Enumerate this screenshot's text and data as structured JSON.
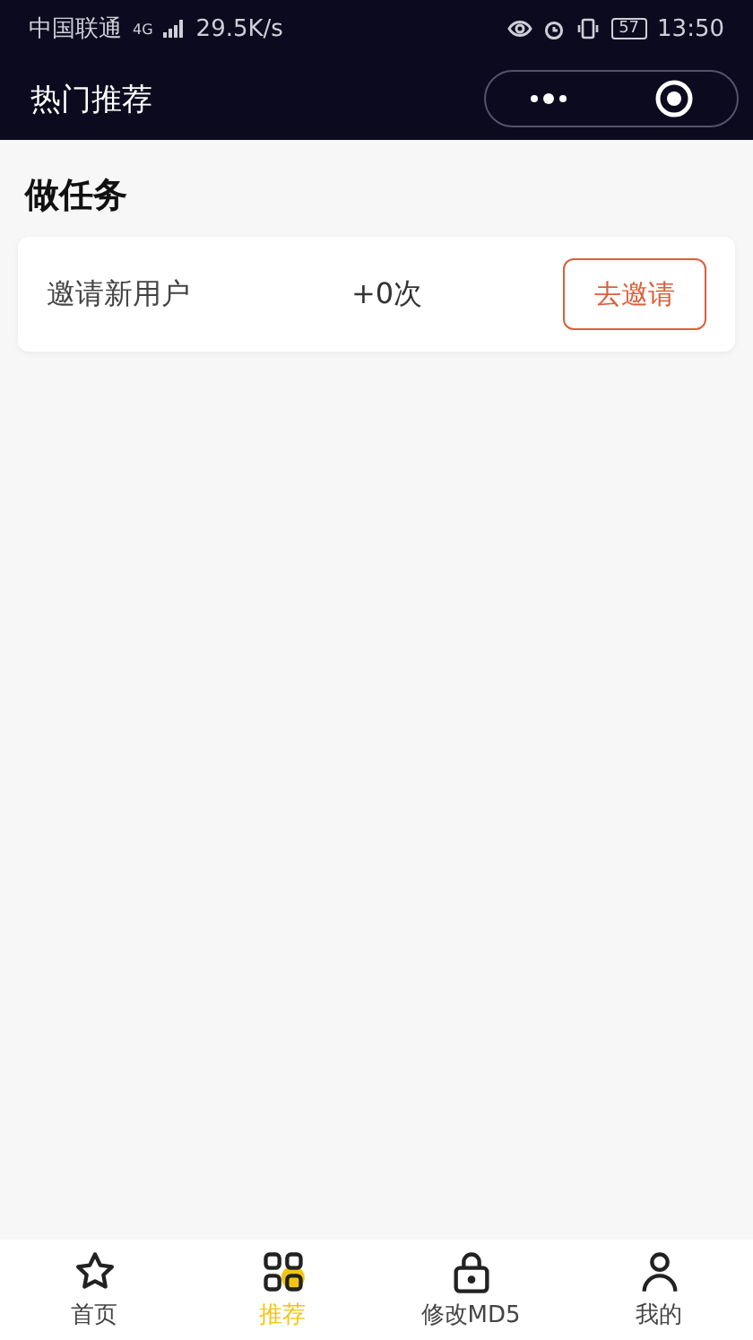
{
  "status_bar": {
    "carrier": "中国联通",
    "network": "4G",
    "speed": "29.5K/s",
    "battery": "57",
    "time": "13:50"
  },
  "nav_bar": {
    "title": "热门推荐"
  },
  "section": {
    "title": "做任务"
  },
  "tasks": [
    {
      "name": "邀请新用户",
      "count": "+0次",
      "action": "去邀请"
    }
  ],
  "tab_bar": [
    {
      "label": "首页",
      "kind": "star",
      "selected": false
    },
    {
      "label": "推荐",
      "kind": "grid",
      "selected": true
    },
    {
      "label": "修改MD5",
      "kind": "lock",
      "selected": false
    },
    {
      "label": "我的",
      "kind": "person",
      "selected": false
    }
  ]
}
